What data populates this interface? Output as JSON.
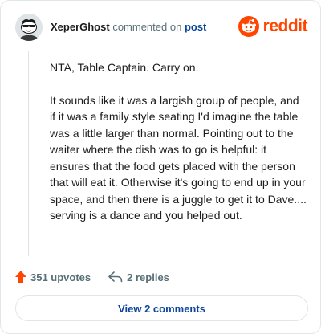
{
  "header": {
    "username": "XeperGhost",
    "action_text": "commented on",
    "post_link": "post",
    "brand": "reddit"
  },
  "comment": {
    "paragraphs": [
      "NTA, Table Captain. Carry on.",
      "It sounds like it was a largish group of people, and if it was a family style seating I'd imagine the table was a little larger than normal. Pointing out to the waiter where the dish was to go is helpful: it ensures that the food gets placed with the person that will eat it. Otherwise it's going to end up in your space, and then there is a juggle to get it to Dave.... serving is a dance and you helped out."
    ]
  },
  "actions": {
    "upvotes": "351 upvotes",
    "replies": "2 replies"
  },
  "footer": {
    "view_comments": "View 2 comments"
  },
  "colors": {
    "brand_orange": "#ff4500",
    "link_blue": "#0a449b",
    "upvote_orange": "#ff4500",
    "muted_text": "#576f76"
  },
  "icons": {
    "avatar": "snoo-avatar-icon",
    "brand": "reddit-logo-icon",
    "upvote": "upvote-arrow-icon",
    "reply": "reply-arrow-icon"
  }
}
